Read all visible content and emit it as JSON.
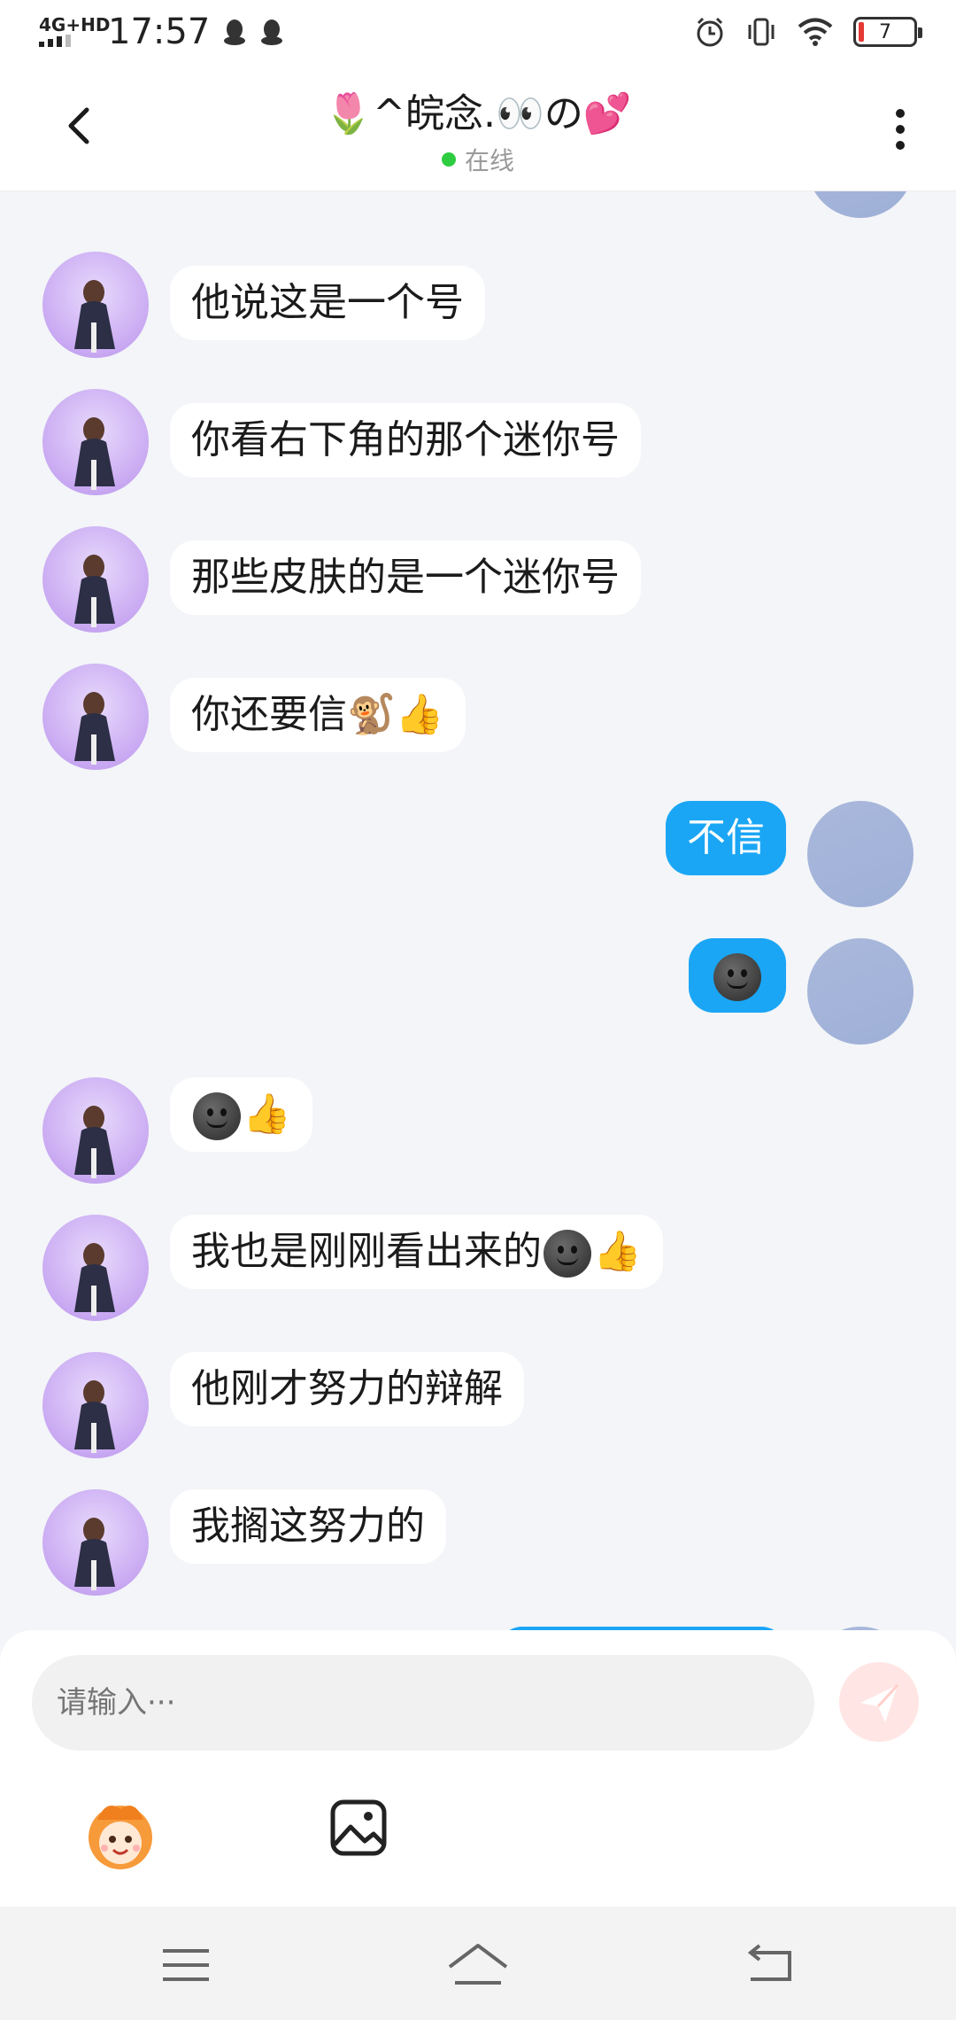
{
  "status_bar": {
    "network": "4G+HD",
    "time": "17:57",
    "battery": "7"
  },
  "header": {
    "title": "🌷^皖念.👀の💕",
    "status": "在线"
  },
  "messages": [
    {
      "side": "left",
      "text": "他说这是一个号"
    },
    {
      "side": "left",
      "text": "你看右下角的那个迷你号"
    },
    {
      "side": "left",
      "text": "那些皮肤的是一个迷你号"
    },
    {
      "side": "left",
      "text": "你还要信🐒👍"
    },
    {
      "side": "right",
      "text": "不信"
    },
    {
      "side": "right",
      "text": "",
      "emoji": "dark-smile-face"
    },
    {
      "side": "left",
      "text": "👍",
      "emoji_before": "dark-smile-face"
    },
    {
      "side": "left",
      "text": "我也是刚刚看出来的",
      "emoji_after": "dark-smile-face",
      "suffix": "👍"
    },
    {
      "side": "left",
      "text": "他刚才努力的辩解"
    },
    {
      "side": "left",
      "text": "我搁这努力的"
    }
  ],
  "composer": {
    "placeholder": "请输入···"
  },
  "colors": {
    "accent_blue": "#1aa6f5",
    "online_green": "#2ecc40",
    "send_button": "#ffe6e4"
  },
  "icons": [
    "back-arrow-icon",
    "more-vert-icon",
    "send-icon",
    "emoji-mascot-icon",
    "image-icon",
    "menu-icon",
    "home-icon",
    "back-nav-icon"
  ]
}
